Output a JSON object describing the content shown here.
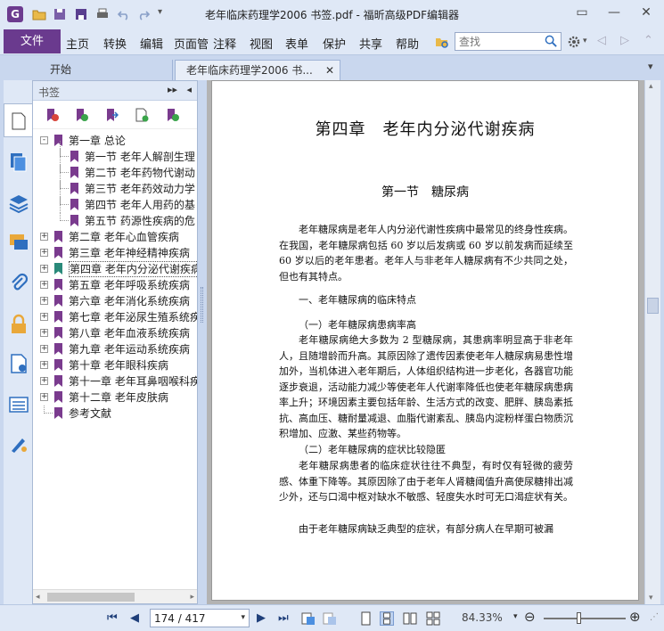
{
  "window": {
    "title": "老年临床药理学2006 书签.pdf - 福昕高级PDF编辑器"
  },
  "menu": {
    "file": "文件",
    "items": [
      "主页",
      "转换",
      "编辑",
      "页面管",
      "注释",
      "视图",
      "表单",
      "保护",
      "共享",
      "帮助"
    ]
  },
  "search": {
    "placeholder": "查找"
  },
  "tabs": [
    {
      "label": "开始"
    },
    {
      "label": "老年临床药理学2006 书..."
    }
  ],
  "bookmarks": {
    "header": "书签",
    "tree": [
      {
        "label": "第一章 总论",
        "level": 0,
        "expander": "-"
      },
      {
        "label": "第一节 老年人解剖生理",
        "level": 1
      },
      {
        "label": "第二节 老年药物代谢动",
        "level": 1
      },
      {
        "label": "第三节 老年药效动力学",
        "level": 1
      },
      {
        "label": "第四节 老年人用药的基",
        "level": 1
      },
      {
        "label": "第五节 药源性疾病的危",
        "level": 1
      },
      {
        "label": "第二章 老年心血管疾病",
        "level": 0,
        "expander": "+"
      },
      {
        "label": "第三章 老年神经精神疾病",
        "level": 0,
        "expander": "+"
      },
      {
        "label": "第四章 老年内分泌代谢疾病",
        "level": 0,
        "expander": "+",
        "selected": true
      },
      {
        "label": "第五章 老年呼吸系统疾病",
        "level": 0,
        "expander": "+"
      },
      {
        "label": "第六章 老年消化系统疾病",
        "level": 0,
        "expander": "+"
      },
      {
        "label": "第七章 老年泌尿生殖系统疾",
        "level": 0,
        "expander": "+"
      },
      {
        "label": "第八章 老年血液系统疾病",
        "level": 0,
        "expander": "+"
      },
      {
        "label": "第九章 老年运动系统疾病",
        "level": 0,
        "expander": "+"
      },
      {
        "label": "第十章 老年眼科疾病",
        "level": 0,
        "expander": "+"
      },
      {
        "label": "第十一章 老年耳鼻咽喉科疾",
        "level": 0,
        "expander": "+"
      },
      {
        "label": "第十二章 老年皮肤病",
        "level": 0,
        "expander": "+"
      },
      {
        "label": "参考文献",
        "level": 0
      }
    ]
  },
  "document": {
    "chapter": "第四章　老年内分泌代谢疾病",
    "section": "第一节　糖尿病",
    "p1": "老年糖尿病是老年人内分泌代谢性疾病中最常见的终身性疾病。在我国，老年糖尿病包括 60 岁以后发病或 60 岁以前发病而延续至 60 岁以后的老年患者。老年人与非老年人糖尿病有不少共同之处，但也有其特点。",
    "h1": "一、老年糖尿病的临床特点",
    "h2": "（一）老年糖尿病患病率高",
    "p2": "老年糖尿病绝大多数为 2 型糖尿病，其患病率明显高于非老年人，且随增龄而升高。其原因除了遗传因素使老年人糖尿病易患性增加外，当机体进入老年期后，人体组织结构进一步老化，各器官功能逐步衰退，活动能力减少等使老年人代谢率降低也使老年糖尿病患病率上升；环境因素主要包括年龄、生活方式的改变、肥胖、胰岛素抵抗、高血压、糖耐量减退、血脂代谢紊乱、胰岛内淀粉样蛋白物质沉积增加、应激、某些药物等。",
    "h3": "（二）老年糖尿病的症状比较隐匿",
    "p3": "老年糖尿病患者的临床症状往往不典型，有时仅有轻微的疲劳感、体重下降等。其原因除了由于老年人肾糖阈值升高使尿糖排出减少外，还与口渴中枢对缺水不敏感、轻度失水时可无口渴症状有关。",
    "p4": "由于老年糖尿病缺乏典型的症状，有部分病人在早期可被漏"
  },
  "status": {
    "page": "174 / 417",
    "zoom": "84.33%"
  },
  "colors": {
    "brand": "#6a3a8e",
    "chrome": "#dfe8f6",
    "accent": "#2f6fbf"
  }
}
